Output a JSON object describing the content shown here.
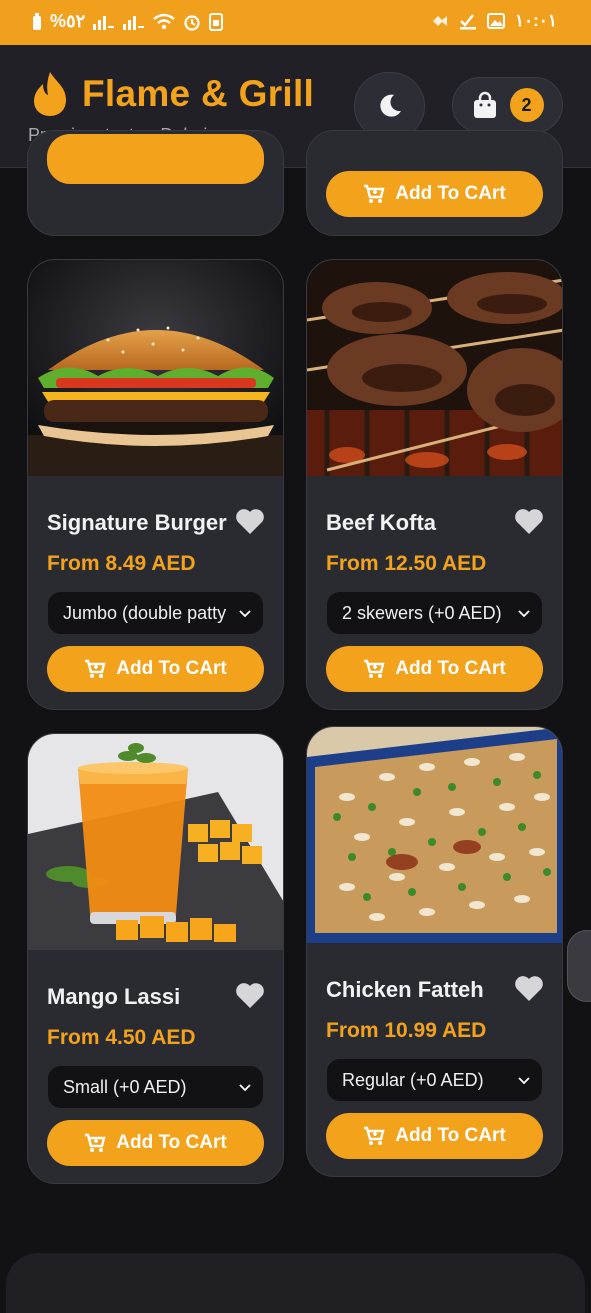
{
  "status_bar": {
    "left": "%٥٢",
    "time": "١٠:٠١"
  },
  "header": {
    "brand_name": "Flame & Grill",
    "tagline": "Premium taste • Dubai",
    "cart_count": "2"
  },
  "top_row": {
    "add_label": "Add To CArt"
  },
  "products": [
    {
      "name": "Signature Burger",
      "price": "From 8.49 AED",
      "option": "Jumbo (double patty",
      "add_label": "Add To CArt",
      "image": "burger"
    },
    {
      "name": "Beef Kofta",
      "price": "From 12.50 AED",
      "option": "2 skewers (+0 AED)",
      "add_label": "Add To CArt",
      "image": "kofta"
    },
    {
      "name": "Mango Lassi",
      "price": "From 4.50 AED",
      "option": "Small (+0 AED)",
      "add_label": "Add To CArt",
      "image": "mango-lassi"
    },
    {
      "name": "Chicken Fatteh",
      "price": "From 10.99 AED",
      "option": "Regular (+0 AED)",
      "add_label": "Add To CArt",
      "image": "fatteh"
    }
  ],
  "colors": {
    "accent": "#f3a21c",
    "card": "#2a2a31",
    "background": "#121214"
  }
}
